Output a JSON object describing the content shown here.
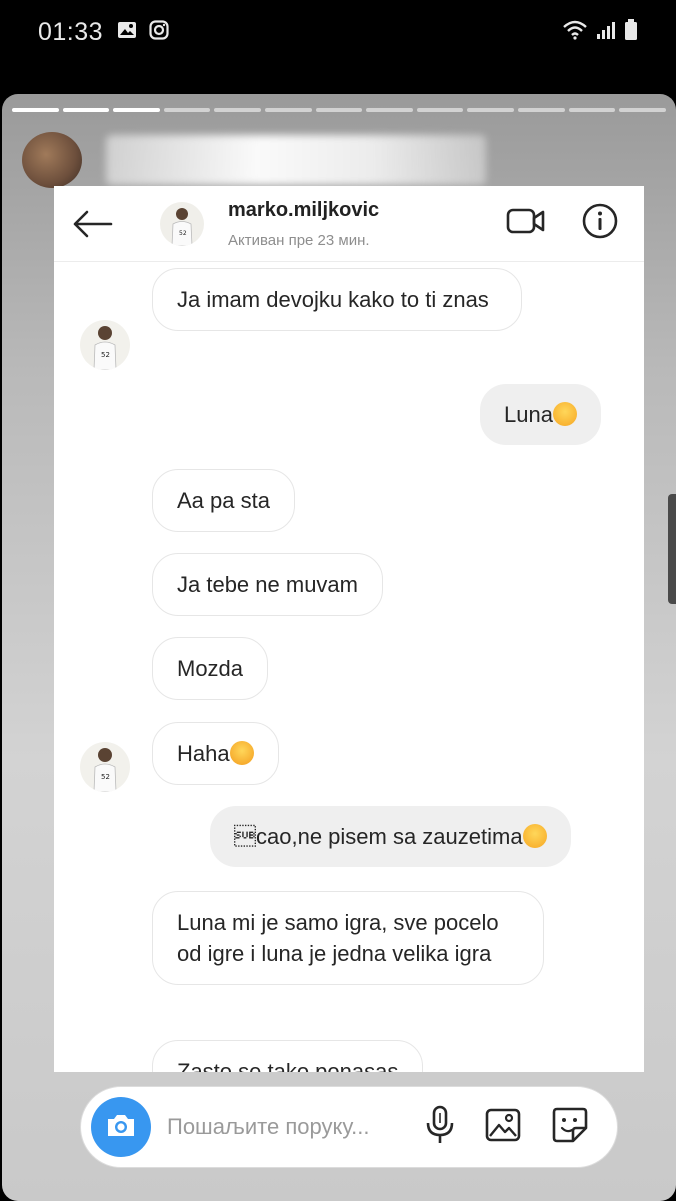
{
  "status_bar": {
    "time": "01:33"
  },
  "dm_header": {
    "username": "marko.miljkovic",
    "status": "Активан пре 23 мин."
  },
  "messages": [
    {
      "side": "in",
      "text": "Ja imam devojku kako to ti znas"
    },
    {
      "side": "out",
      "text": "Luna",
      "emoji": "smiling-face-icon"
    },
    {
      "side": "in",
      "text": "Aa pa sta"
    },
    {
      "side": "in",
      "text": "Ja tebe ne muvam"
    },
    {
      "side": "in",
      "text": "Mozda"
    },
    {
      "side": "in",
      "text": "Haha",
      "emoji": "winking-face-icon"
    },
    {
      "side": "out",
      "text": "\u001acao,ne pisem sa zauzetima",
      "emoji": "smiling-face-icon"
    },
    {
      "side": "in",
      "text": "Luna mi je samo igra,  sve pocelo od igre i luna je jedna velika igra"
    },
    {
      "side": "in",
      "text": "Zasto se tako ponasas"
    }
  ],
  "composer": {
    "placeholder": "Пошаљите поруку..."
  },
  "colors": {
    "accent": "#3897f0",
    "bubble_out": "#efefef",
    "bubble_in_border": "#e6e6e6"
  }
}
